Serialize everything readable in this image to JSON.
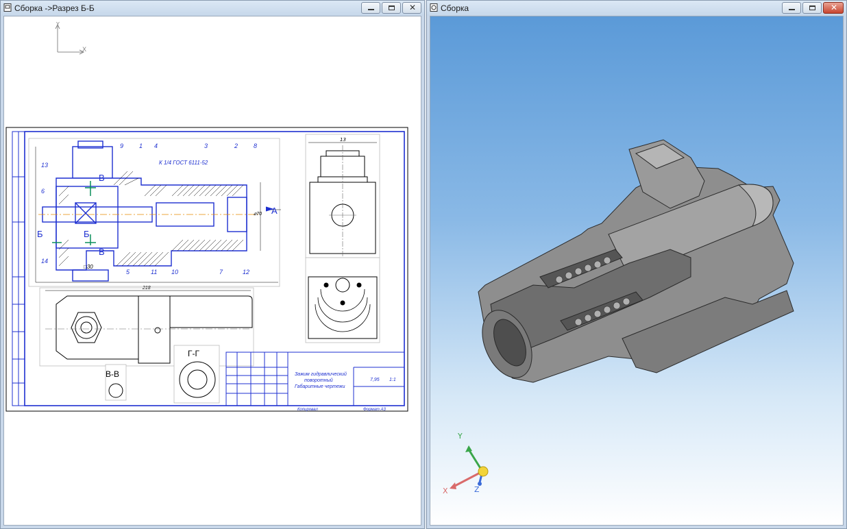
{
  "left_window": {
    "title": "Сборка ->Разрез Б-Б"
  },
  "right_window": {
    "title": "Сборка"
  },
  "drawing": {
    "axis_y": "Y",
    "axis_x": "X",
    "spec_label": "К 1/4 ГОСТ 6111-52",
    "callouts": [
      "9",
      "1",
      "4",
      "3",
      "2",
      "8",
      "13",
      "6",
      "5",
      "11",
      "10",
      "7",
      "12",
      "14"
    ],
    "view_a": "А",
    "section_bb": "В-В",
    "section_gg": "Г-Г",
    "label_b": "Б",
    "label_v": "В",
    "dim_top": "13",
    "dim_218": "218",
    "dim_30": "□30",
    "dim_70": "⌀70",
    "title_block_name": [
      "Зажим гидравлический",
      "поворотный",
      "Габаритные чертежи"
    ],
    "title_block_scale": "7,95",
    "title_block_ratio": "1:1",
    "footer_left": "Копировал",
    "footer_right": "Формат   А3"
  },
  "triad": {
    "x": "X",
    "y": "Y",
    "z": "Z"
  }
}
